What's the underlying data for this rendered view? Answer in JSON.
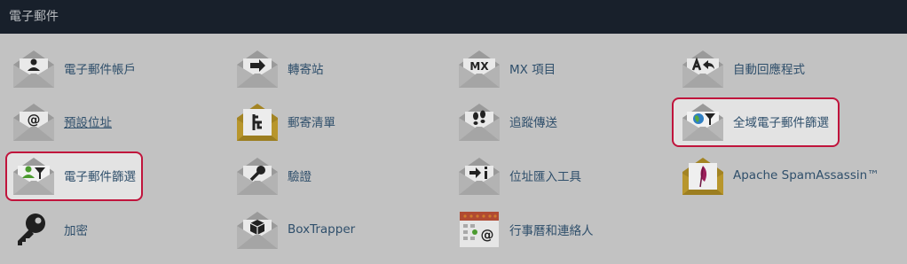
{
  "header": {
    "title": "電子郵件"
  },
  "colors": {
    "accent_highlight": "#c0143c",
    "header_bg": "#18202b",
    "link": "#2f4f6b"
  },
  "items": [
    {
      "label": "電子郵件帳戶",
      "icon": "person-envelope-icon"
    },
    {
      "label": "轉寄站",
      "icon": "arrow-right-envelope-icon"
    },
    {
      "label": "MX 項目",
      "icon": "mx-envelope-icon",
      "icon_text": "MX"
    },
    {
      "label": "自動回應程式",
      "icon": "auto-reply-envelope-icon"
    },
    {
      "label": "預設位址",
      "icon": "at-envelope-icon"
    },
    {
      "label": "郵寄清單",
      "icon": "mailing-list-envelope-icon"
    },
    {
      "label": "追蹤傳送",
      "icon": "footprints-envelope-icon"
    },
    {
      "label": "全域電子郵件篩選",
      "icon": "global-filter-envelope-icon"
    },
    {
      "label": "電子郵件篩選",
      "icon": "user-filter-envelope-icon"
    },
    {
      "label": "驗證",
      "icon": "key-envelope-icon"
    },
    {
      "label": "位址匯入工具",
      "icon": "import-envelope-icon"
    },
    {
      "label": "Apache SpamAssassin™",
      "icon": "feather-envelope-icon"
    },
    {
      "label": "加密",
      "icon": "key-icon"
    },
    {
      "label": "BoxTrapper",
      "icon": "box-envelope-icon"
    },
    {
      "label": "行事曆和連絡人",
      "icon": "calendar-contacts-icon"
    }
  ]
}
